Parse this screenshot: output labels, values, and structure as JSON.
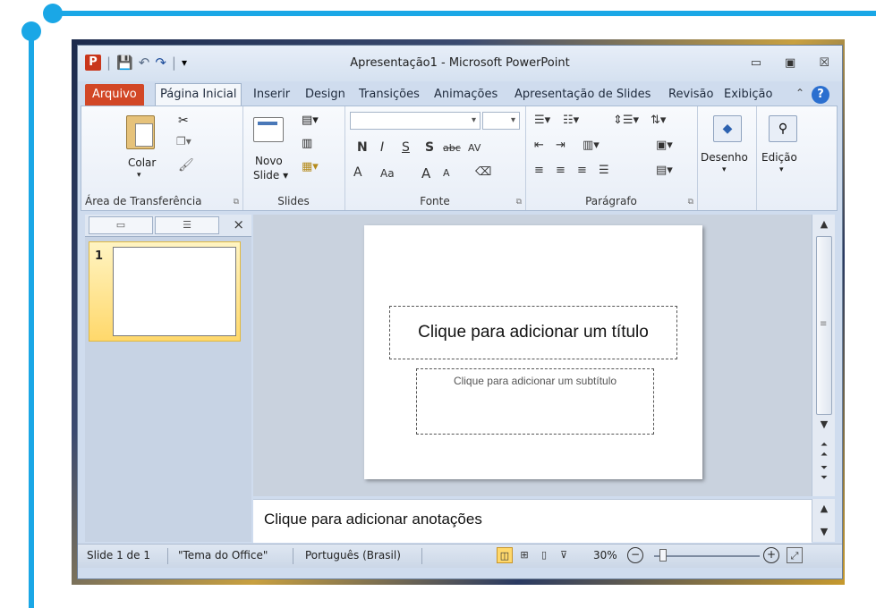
{
  "window": {
    "title": "Apresentação1 - Microsoft PowerPoint",
    "app_icon_letter": "P",
    "buttons": {
      "minimize": "▭",
      "maximize": "▣",
      "close": "☒"
    }
  },
  "quick_access": {
    "save_icon": "💾",
    "undo": "↶",
    "redo": "↷",
    "sep": "|",
    "customize": "▾"
  },
  "tabs": [
    "Arquivo",
    "Página Inicial",
    "Inserir",
    "Design",
    "Transições",
    "Animações",
    "Apresentação de Slides",
    "Revisão",
    "Exibição"
  ],
  "help_label": "?",
  "ribbon": {
    "clipboard": {
      "paste_label": "Colar",
      "group_label": "Área de Transferência"
    },
    "slides": {
      "new_slide_label_1": "Novo",
      "new_slide_label_2": "Slide ▾",
      "group_label": "Slides"
    },
    "font": {
      "group_label": "Fonte",
      "bold": "N",
      "italic": "I",
      "underline": "S",
      "shadow": "S",
      "strike": "abc",
      "spacing": "AV",
      "font_color": "A",
      "size_change": "Aa",
      "grow": "A",
      "shrink": "A"
    },
    "paragraph": {
      "group_label": "Parágrafo"
    },
    "drawing": {
      "label": "Desenho"
    },
    "editing": {
      "label": "Edição"
    }
  },
  "left_pane": {
    "slide_number": "1",
    "close": "×"
  },
  "slide": {
    "title_placeholder": "Clique para adicionar um título",
    "subtitle_placeholder": "Clique para adicionar um subtítulo"
  },
  "notes_placeholder": "Clique para adicionar anotações",
  "status": {
    "slide_count": "Slide 1 de 1",
    "theme": "\"Tema do Office\"",
    "language": "Português (Brasil)",
    "zoom": "30%",
    "zoom_out": "−",
    "zoom_in": "+"
  },
  "colors": {
    "accent_line": "#1aa7e6",
    "file_tab": "#d24726",
    "active_thumb": "#ffd86b"
  }
}
